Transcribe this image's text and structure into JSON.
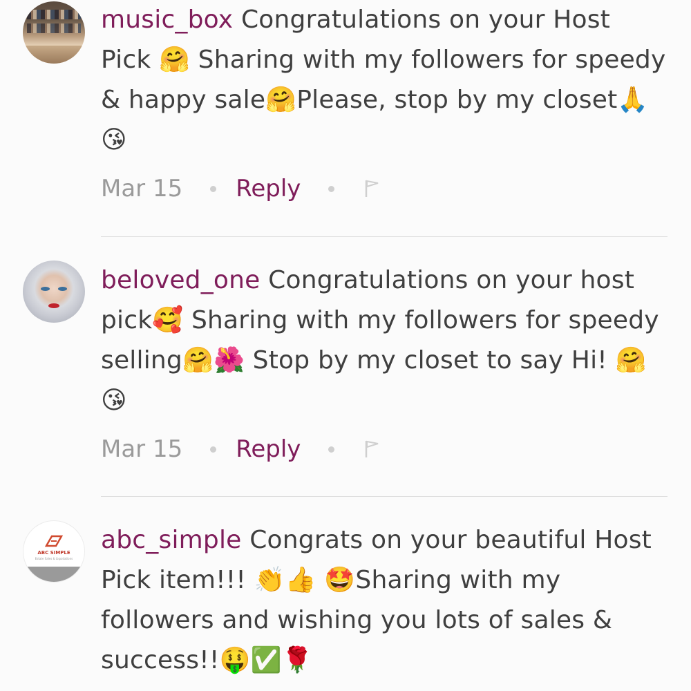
{
  "comments": [
    {
      "username": "music_box",
      "text": " Congratulations on your Host Pick 🤗 Sharing with my followers for speedy & happy sale🤗Please, stop by my closet🙏😘",
      "date": "Mar 15",
      "reply_label": "Reply"
    },
    {
      "username": "beloved_one",
      "text": " Congratulations on your host pick🥰 Sharing with my followers for speedy selling🤗🌺 Stop by my closet to say Hi! 🤗😘",
      "date": "Mar 15",
      "reply_label": "Reply"
    },
    {
      "username": "abc_simple",
      "text": " Congrats on your beautiful Host Pick item!!! 👏👍 🤩Sharing with my followers and wishing you lots of sales & success!!🤑✅🌹",
      "avatar_logo_text": "ABC SIMPLE",
      "avatar_logo_subtext": "Estate Sales & Liquidations"
    }
  ],
  "icons": {
    "flag": "flag-icon",
    "separator": "dot-separator"
  },
  "colors": {
    "username": "#7f1d5a",
    "reply": "#7f1d5a",
    "date": "#9a9a9a",
    "body": "#3f3f3f",
    "background": "#fbfbfb",
    "divider": "#dedede"
  }
}
